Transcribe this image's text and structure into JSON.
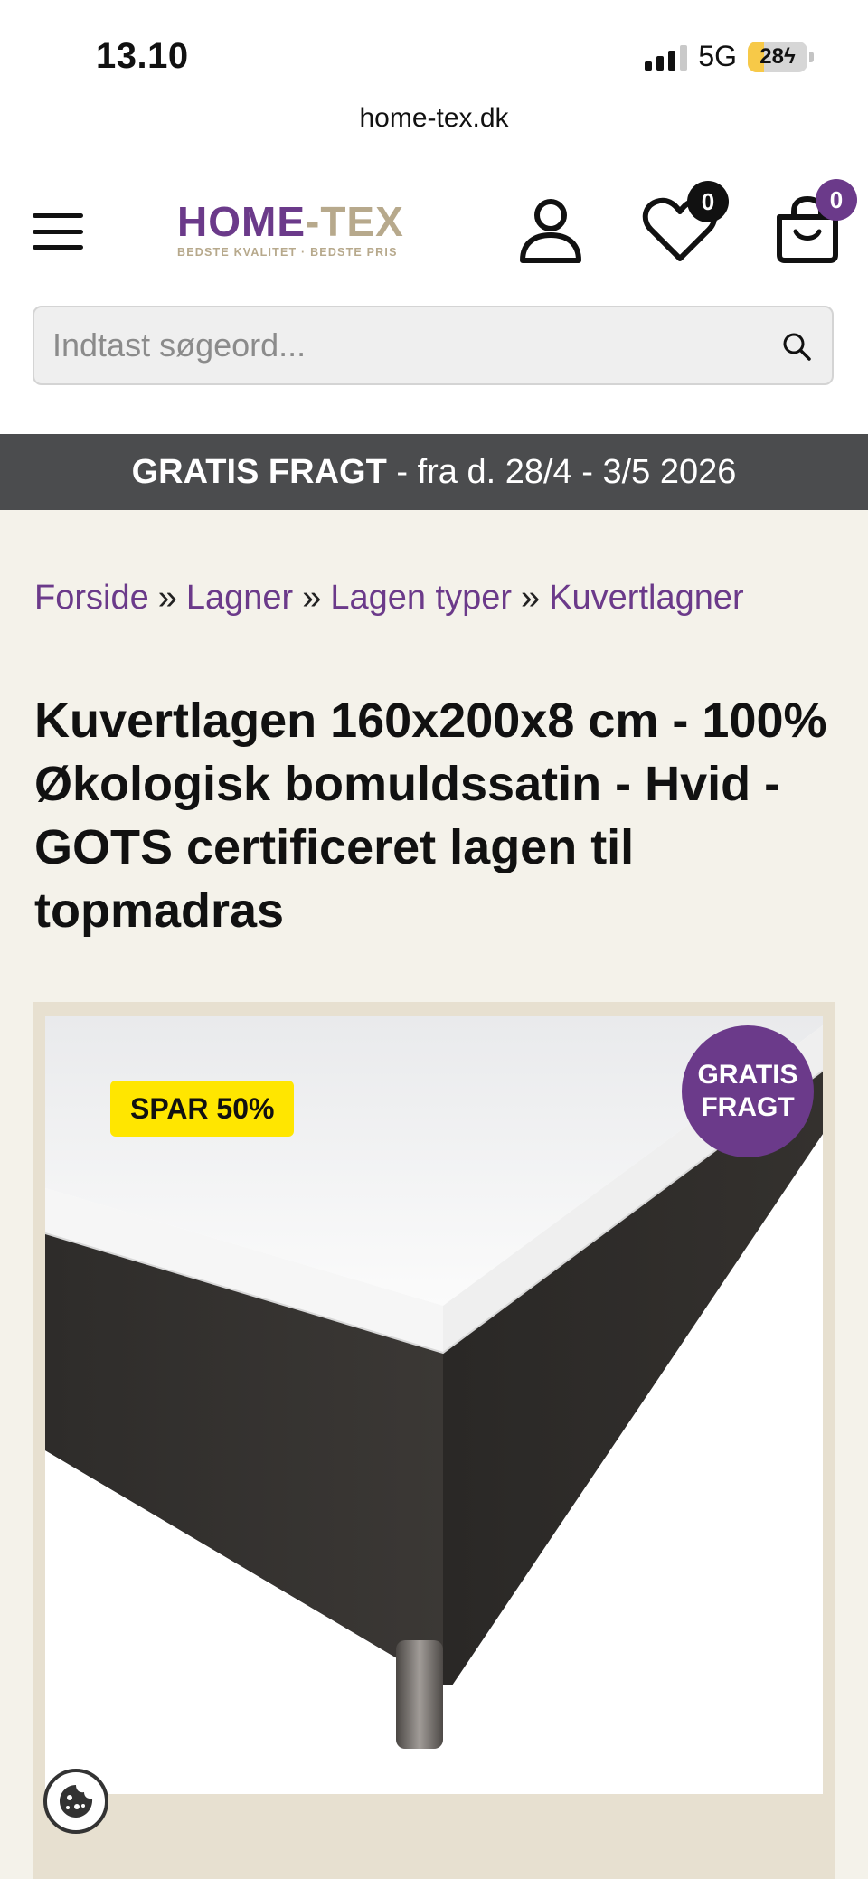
{
  "status_bar": {
    "time": "13.10",
    "network": "5G",
    "battery": "28"
  },
  "browser": {
    "url": "home-tex.dk"
  },
  "header": {
    "logo_main_left": "HOME",
    "logo_main_dash": "-",
    "logo_main_right": "TEX",
    "logo_tagline": "BEDSTE KVALITET · BEDSTE PRIS",
    "wishlist_count": "0",
    "cart_count": "0",
    "icons": [
      "menu-icon",
      "account-icon",
      "heart-icon",
      "cart-icon"
    ]
  },
  "search": {
    "placeholder": "Indtast søgeord..."
  },
  "promo": {
    "bold": "GRATIS FRAGT",
    "rest": " - fra d. 28/4 - 3/5 2026"
  },
  "breadcrumb": {
    "items": [
      "Forside",
      "Lagner",
      "Lagen typer",
      "Kuvertlagner"
    ],
    "separator": "»"
  },
  "product": {
    "title": "Kuvertlagen 160x200x8 cm - 100% Økologisk bomuldssatin - Hvid - GOTS certificeret lagen til topmadras",
    "discount_badge": "SPAR 50%",
    "shipping_badge_line1": "GRATIS",
    "shipping_badge_line2": "FRAGT"
  },
  "colors": {
    "brand_purple": "#6b3a8a",
    "brand_beige": "#b7a98c",
    "promo_bar": "#4b4c4e",
    "discount_yellow": "#ffe600",
    "page_bg": "#f4f2ea"
  }
}
